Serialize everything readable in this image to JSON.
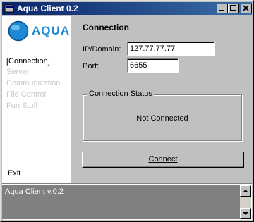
{
  "window": {
    "title": "Aqua Client 0.2"
  },
  "logo": {
    "text": "AQUA"
  },
  "sidebar": {
    "items": [
      {
        "label": "[Connection]",
        "state": "active"
      },
      {
        "label": "Server",
        "state": "disabled"
      },
      {
        "label": "Communication",
        "state": "disabled"
      },
      {
        "label": "File Control",
        "state": "disabled"
      },
      {
        "label": "Fun Stuff",
        "state": "disabled"
      }
    ],
    "exit_label": "Exit"
  },
  "main": {
    "heading": "Connection",
    "ip_label": "IP/Domain:",
    "ip_value": "127.77.77.77",
    "port_label": "Port:",
    "port_value": "6655",
    "status_group_title": "Connection Status",
    "status_text": "Not Connected",
    "connect_button": "Connect"
  },
  "log": {
    "text": "Aqua Client v.0.2"
  },
  "colors": {
    "titlebar_start": "#0a246a",
    "titlebar_end": "#3a6ea5",
    "logo_blue": "#1e8ad6"
  }
}
